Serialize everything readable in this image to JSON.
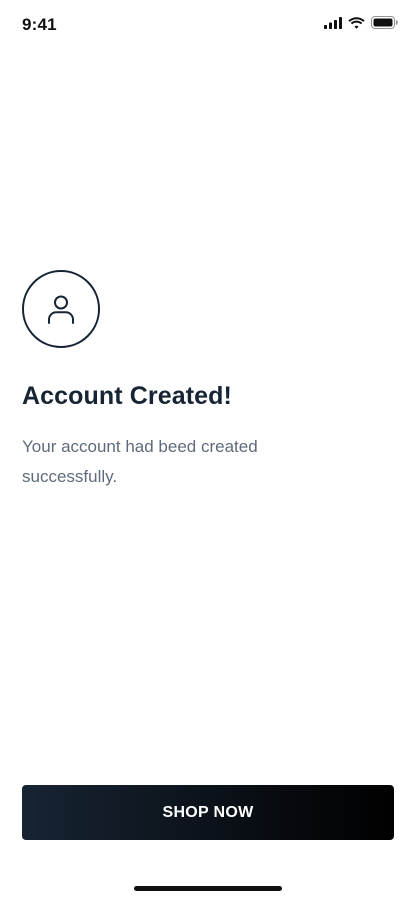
{
  "status_bar": {
    "time": "9:41",
    "icons": [
      "cellular-signal-icon",
      "wifi-icon",
      "battery-icon"
    ]
  },
  "content": {
    "icon": "user-icon",
    "title": "Account Created!",
    "message": "Your account had beed created successfully."
  },
  "cta": {
    "label": "SHOP NOW"
  },
  "colors": {
    "primary_text": "#172433",
    "secondary_text": "#5f6b7a",
    "button_gradient_start": "#172433",
    "button_gradient_end": "#000000"
  }
}
